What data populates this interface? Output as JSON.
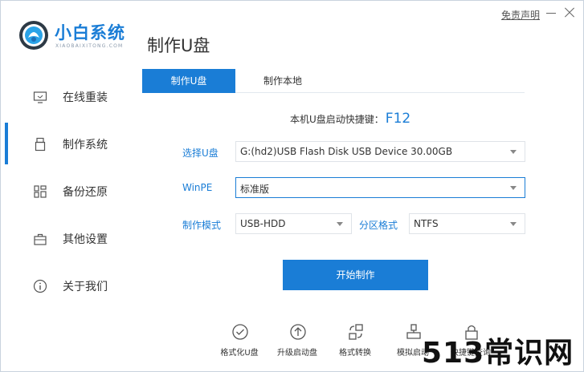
{
  "app": {
    "name": "小白系统",
    "subtitle": "XIAOBAIXITONG.COM",
    "disclaimer": "免责声明",
    "page_title": "制作U盘",
    "accent_color": "#1a7dd6"
  },
  "sidebar": {
    "items": [
      {
        "label": "在线重装",
        "icon": "monitor-icon",
        "active": false
      },
      {
        "label": "制作系统",
        "icon": "usb-drive-icon",
        "active": true
      },
      {
        "label": "备份还原",
        "icon": "backup-icon",
        "active": false
      },
      {
        "label": "其他设置",
        "icon": "briefcase-icon",
        "active": false
      },
      {
        "label": "关于我们",
        "icon": "info-icon",
        "active": false
      }
    ]
  },
  "tabs": [
    {
      "label": "制作U盘",
      "active": true
    },
    {
      "label": "制作本地",
      "active": false
    }
  ],
  "hotkey": {
    "label": "本机U盘启动快捷键：",
    "key": "F12"
  },
  "form": {
    "usb_label": "选择U盘",
    "usb_value": "G:(hd2)USB Flash Disk USB Device 30.00GB",
    "winpe_label": "WinPE",
    "winpe_value": "标准版",
    "mode_label": "制作模式",
    "mode_value": "USB-HDD",
    "partition_label": "分区格式",
    "partition_value": "NTFS"
  },
  "start_button": "开始制作",
  "tools": [
    {
      "label": "格式化U盘",
      "icon": "check-circle-icon"
    },
    {
      "label": "升级启动盘",
      "icon": "upgrade-icon"
    },
    {
      "label": "格式转换",
      "icon": "convert-icon"
    },
    {
      "label": "模拟启动",
      "icon": "simulate-icon"
    },
    {
      "label": "快捷键查询",
      "icon": "lock-icon"
    }
  ],
  "watermark": "513常识网"
}
